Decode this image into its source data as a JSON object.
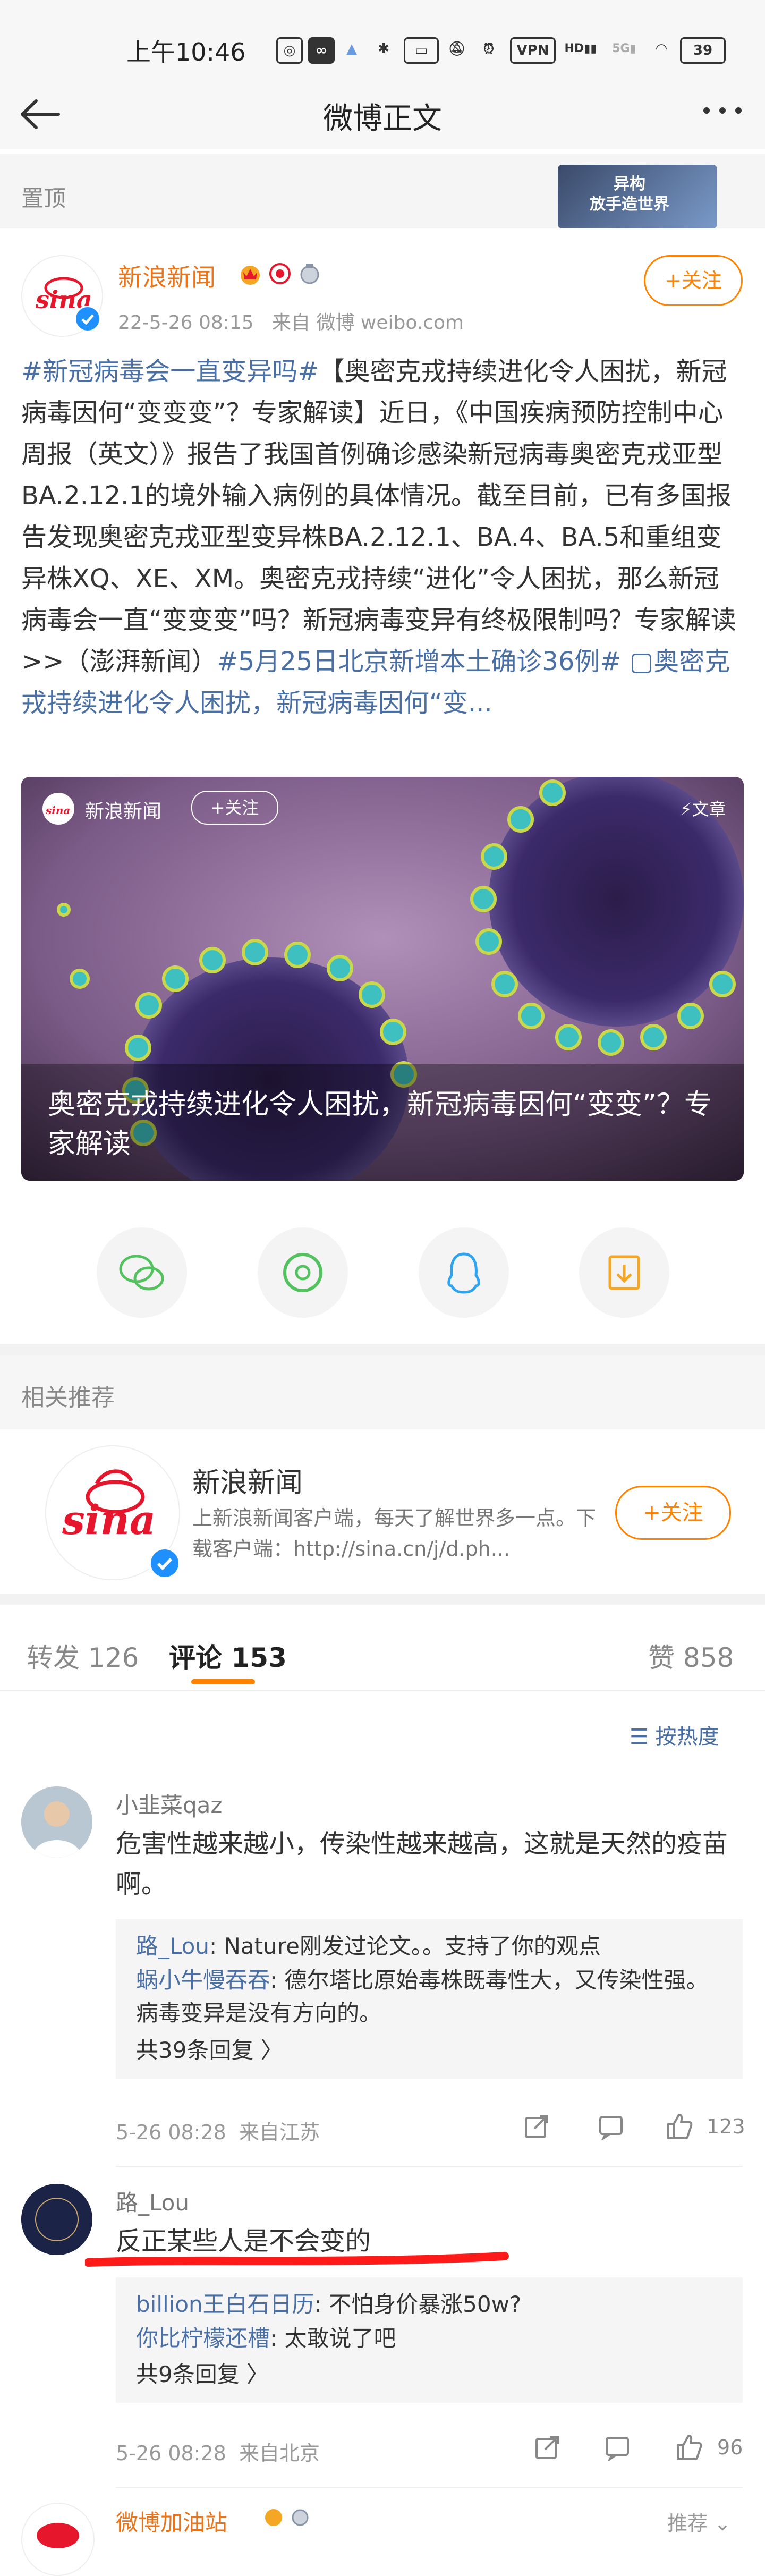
{
  "status_bar": {
    "time": "上午10:46",
    "vpn": "VPN",
    "hd": "HD",
    "signal": "5G",
    "battery": "39"
  },
  "header": {
    "title": "微博正文"
  },
  "pinned": {
    "label": "置顶",
    "ad_text": "异构\n放手造世界"
  },
  "post": {
    "author": "新浪新闻",
    "date": "22-5-26 08:15",
    "source": "来自 微博 weibo.com",
    "follow_label": "+关注",
    "segments": [
      {
        "text": "#新冠病毒会一直变异吗#",
        "kind": "tag"
      },
      {
        "text": "【奥密克戎持续进化令人困扰，新冠病毒因何“变变变”？专家解读】近日，《中国疾病预防控制中心周报（英文）》报告了我国首例确诊感染新冠病毒奥密克戎亚型BA.2.12.1的境外输入病例的具体情况。截至目前，已有多国报告发现奥密克戎亚型变异株BA.2.12.1、BA.4、BA.5和重组变异株XQ、XE、XM。奥密克戎持续“进化”令人困扰，那么新冠病毒会一直“变变变”吗？新冠病毒变异有终极限制吗？专家解读>>（澎湃新闻）",
        "kind": "text"
      },
      {
        "text": "#5月25日北京新增本土确诊36例#",
        "kind": "tag"
      },
      {
        "text": " ",
        "kind": "text"
      },
      {
        "text": "▢奥密克戎持续进化令人困扰，新冠病毒因何“变...",
        "kind": "tag"
      }
    ],
    "media": {
      "source_name": "新浪新闻",
      "follow_label": "+关注",
      "badge": "文章",
      "caption": "奥密克戎持续进化令人困扰，新冠病毒因何“变变”？专家解读"
    },
    "share_buttons": [
      {
        "name": "wechat"
      },
      {
        "name": "moments"
      },
      {
        "name": "qq"
      },
      {
        "name": "save-image"
      }
    ]
  },
  "related": {
    "label": "相关推荐",
    "name": "新浪新闻",
    "desc": "上新浪新闻客户端，每天了解世界多一点。下载客户端：http://sina.cn/j/d.ph...",
    "follow_label": "+关注"
  },
  "tabs": {
    "repost": "转发 126",
    "comments": "评论 153",
    "likes": "赞 858",
    "sort": "按热度"
  },
  "comments": [
    {
      "user": "小韭菜qaz",
      "text": "危害性越来越小，传染性越来越高，这就是天然的疫苗啊。",
      "replies": [
        {
          "user": "路_Lou",
          "text": ": Nature刚发过论文。。支持了你的观点"
        },
        {
          "user": "蜗小牛慢吞吞",
          "text": ": 德尔塔比原始毒株既毒性大，又传染性强。病毒变异是没有方向的。"
        }
      ],
      "more_replies": "共39条回复 〉",
      "time": "5-26 08:28",
      "location": "来自江苏",
      "likes": "123"
    },
    {
      "user": "路_Lou",
      "text": "反正某些人是不会变的",
      "replies": [
        {
          "user": "billion王白石日历",
          "text": ": 不怕身价暴涨50w?"
        },
        {
          "user": "你比柠檬还槽",
          "text": ": 太敢说了吧"
        }
      ],
      "more_replies": "共9条回复 〉",
      "time": "5-26 08:28",
      "location": "来自北京",
      "likes": "96"
    },
    {
      "user": "微博加油站",
      "recommend": "推荐"
    }
  ],
  "colors": {
    "accent": "#ff8200",
    "link": "#4a6fa5",
    "brand_red": "#e6162d",
    "underline_red": "#ff1a1a"
  }
}
